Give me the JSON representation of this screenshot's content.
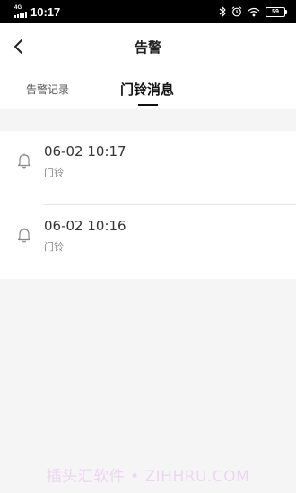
{
  "status_bar": {
    "network": "4G",
    "time": "10:17",
    "battery": "59"
  },
  "header": {
    "title": "告警"
  },
  "tabs": [
    {
      "label": "告警记录",
      "active": false
    },
    {
      "label": "门铃消息",
      "active": true
    }
  ],
  "alarms": [
    {
      "time": "06-02 10:17",
      "type": "门铃",
      "icon": "bell-icon"
    },
    {
      "time": "06-02 10:16",
      "type": "门铃",
      "icon": "bell-icon"
    }
  ],
  "watermark": "插头汇软件 • ZIHHRU.COM",
  "colors": {
    "active_tab": "#111111",
    "inactive_tab": "#555555",
    "background": "#f5f5f5"
  }
}
